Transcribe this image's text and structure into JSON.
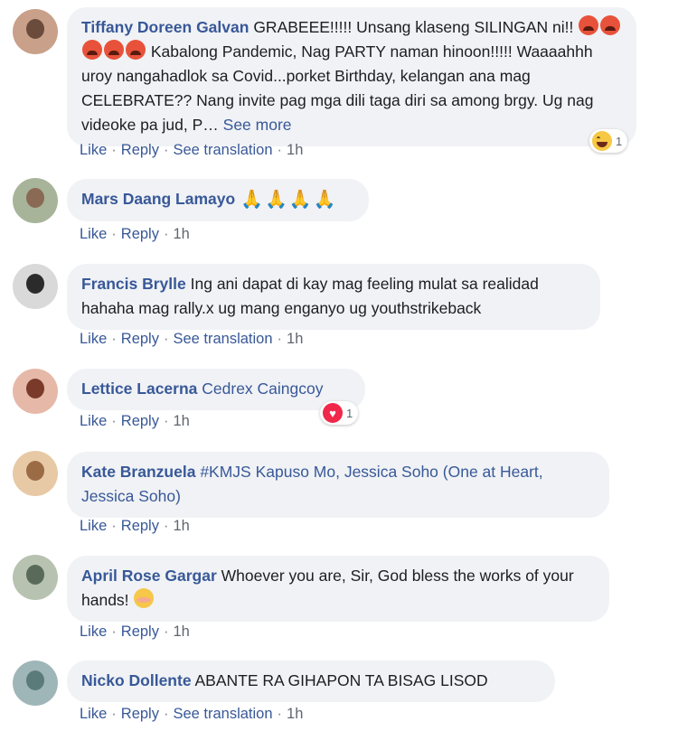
{
  "comments": [
    {
      "name": "Tiffany Doreen Galvan",
      "text_a": "GRABEEE!!!!! Unsang klaseng SILINGAN ni!!",
      "text_b": "Kabalong Pandemic, Nag PARTY naman hinoon!!!!! Waaaahhh uroy nangahadlok sa Covid...porket Birthday, kelangan ana mag CELEBRATE?? Nang invite pag mga dili taga diri sa among brgy. Ug nag videoke pa jud, P…",
      "inline_emoji": "rage-face-icon",
      "see_more": "See more",
      "like": "Like",
      "reply": "Reply",
      "see_translation": "See translation",
      "time": "1h",
      "reaction_icon": "haha-icon",
      "reaction_count": "1",
      "avatar_colors": [
        "#c9a08a",
        "#6b4b3b"
      ]
    },
    {
      "name": "Mars Daang Lamayo",
      "inline_emoji": "folded-hands-icon",
      "like": "Like",
      "reply": "Reply",
      "time": "1h",
      "avatar_colors": [
        "#a7b49a",
        "#8a6a55"
      ]
    },
    {
      "name": "Francis Brylle",
      "text": "Ing ani dapat di kay mag feeling mulat sa realidad hahaha mag rally.x ug mang enganyo ug youthstrikeback",
      "like": "Like",
      "reply": "Reply",
      "see_translation": "See translation",
      "time": "1h",
      "avatar_colors": [
        "#d9d9d9",
        "#2b2b2b"
      ]
    },
    {
      "name": "Lettice Lacerna",
      "tag": "Cedrex Caingcoy",
      "like": "Like",
      "reply": "Reply",
      "time": "1h",
      "reaction_icon": "heart-icon",
      "reaction_count": "1",
      "avatar_colors": [
        "#e6b8a8",
        "#7a3a2a"
      ]
    },
    {
      "name": "Kate Branzuela",
      "tag": "#KMJS Kapuso Mo, Jessica Soho (One at Heart, Jessica Soho)",
      "like": "Like",
      "reply": "Reply",
      "time": "1h",
      "avatar_colors": [
        "#e8c9a5",
        "#9a6b45"
      ]
    },
    {
      "name": "April Rose Gargar",
      "text": "Whoever you are, Sir, God bless the works of your hands!",
      "inline_emoji": "blushing-face-icon",
      "like": "Like",
      "reply": "Reply",
      "time": "1h",
      "avatar_colors": [
        "#b7c2b0",
        "#5a6a5a"
      ]
    },
    {
      "name": "Nicko Dollente",
      "text": "ABANTE RA GIHAPON TA BISAG LISOD",
      "like": "Like",
      "reply": "Reply",
      "see_translation": "See translation",
      "time": "1h",
      "avatar_colors": [
        "#9fb6b8",
        "#5b7a7a"
      ]
    }
  ]
}
